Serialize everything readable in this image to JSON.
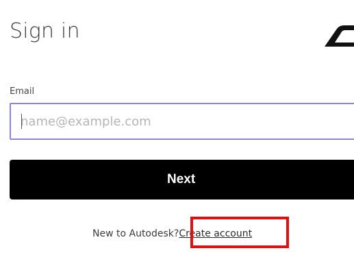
{
  "page": {
    "title": "Sign in"
  },
  "form": {
    "email_label": "Email",
    "email_placeholder": "name@example.com",
    "email_value": "",
    "next_label": "Next"
  },
  "footer": {
    "prompt": "New to Autodesk?",
    "create_account_label": "Create account"
  },
  "icons": {
    "logo": "autodesk-logo-icon"
  },
  "colors": {
    "input_focus_border": "#8a84e8",
    "button_bg": "#000000",
    "highlight": "#e01010"
  }
}
